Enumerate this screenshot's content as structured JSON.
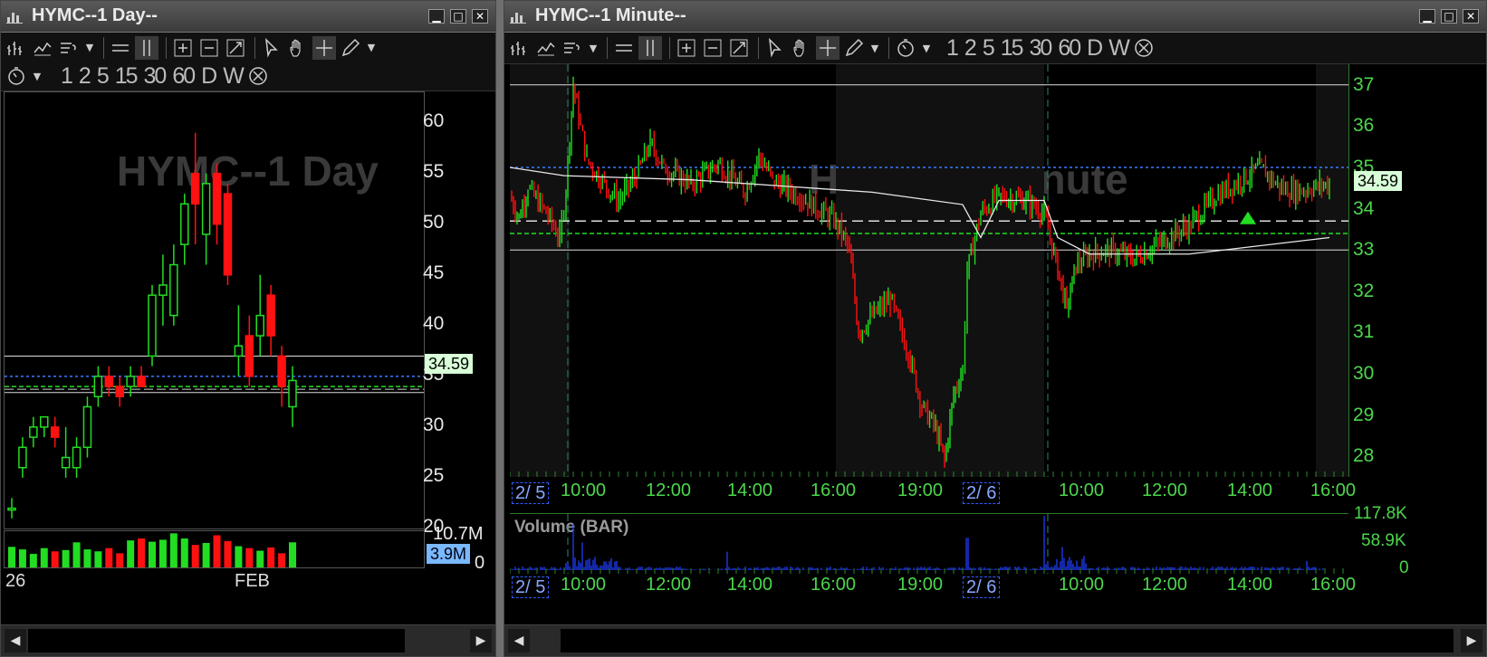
{
  "colors": {
    "up": "#22dd22",
    "down": "#ff1111",
    "level_green": "#22dd22",
    "level_blue": "#3a7bff",
    "volume": "#1e3cff",
    "accent": "#4cd64c"
  },
  "left_window": {
    "title": "HYMC--1 Day--",
    "watermark": "HYMC--1 Day",
    "timeframes": [
      "1",
      "2",
      "5",
      "15",
      "30",
      "60",
      "D",
      "W"
    ],
    "y_labels": [
      "60",
      "55",
      "50",
      "45",
      "40",
      "35",
      "30",
      "25",
      "20"
    ],
    "price_tag": "34.59",
    "volume_max": "10.7M",
    "volume_tag": "3.9M",
    "volume_zero": "0",
    "x_labels": [
      "26",
      "FEB"
    ]
  },
  "right_window": {
    "title": "HYMC--1 Minute--",
    "watermark": "HYMC--1 Minute",
    "timeframes": [
      "1",
      "2",
      "5",
      "15",
      "30",
      "60",
      "D",
      "W"
    ],
    "y_labels": [
      "37",
      "36",
      "35",
      "34",
      "33",
      "32",
      "31",
      "30",
      "29",
      "28"
    ],
    "price_tag": "34.59",
    "x_labels": [
      "10:00",
      "12:00",
      "14:00",
      "16:00",
      "19:00",
      "10:00",
      "12:00",
      "14:00",
      "16:00"
    ],
    "date_labels": [
      "2/ 5",
      "2/ 6"
    ],
    "volume_title": "Volume (BAR)",
    "volume_labels": [
      "117.8K",
      "58.9K",
      "0"
    ]
  },
  "chart_data": [
    {
      "type": "candlestick",
      "series_name": "HYMC",
      "timeframe": "1 Day",
      "ohlc": [
        [
          22,
          23,
          21,
          22
        ],
        [
          26,
          29,
          25,
          28
        ],
        [
          29,
          31,
          28,
          30
        ],
        [
          30,
          31,
          29,
          31
        ],
        [
          30,
          31,
          28,
          29
        ],
        [
          26,
          30,
          25,
          27
        ],
        [
          26,
          29,
          25,
          28
        ],
        [
          28,
          33,
          27,
          32
        ],
        [
          33,
          36,
          32,
          35
        ],
        [
          35,
          36,
          33,
          34
        ],
        [
          34,
          35,
          32,
          33
        ],
        [
          34,
          36,
          33,
          35
        ],
        [
          35,
          36,
          34,
          34
        ],
        [
          37,
          44,
          36,
          43
        ],
        [
          43,
          47,
          40,
          44
        ],
        [
          41,
          48,
          40,
          46
        ],
        [
          48,
          53,
          46,
          52
        ],
        [
          55,
          59,
          48,
          52
        ],
        [
          49,
          55,
          46,
          54
        ],
        [
          55,
          56,
          48,
          50
        ],
        [
          53,
          54,
          44,
          45
        ],
        [
          37,
          42,
          35,
          38
        ],
        [
          39,
          41,
          34,
          35
        ],
        [
          39,
          45,
          37,
          41
        ],
        [
          43,
          44,
          37,
          39
        ],
        [
          37,
          38,
          32,
          34
        ],
        [
          32,
          36,
          30,
          34.59
        ]
      ],
      "volume": [
        3.2,
        2.8,
        2.1,
        3.0,
        2.5,
        2.7,
        3.9,
        2.8,
        2.5,
        3.0,
        2.2,
        4.2,
        4.5,
        4.0,
        4.3,
        5.3,
        4.5,
        3.5,
        3.8,
        5.0,
        4.1,
        3.3,
        3.0,
        2.6,
        3.1,
        2.2,
        3.9
      ],
      "y_range": [
        20,
        63
      ],
      "volume_max": 10.7,
      "levels": {
        "upper_white": 37,
        "blue": 35,
        "green": 34,
        "lower_white": 33.4
      },
      "last_price": 34.59
    },
    {
      "type": "candlestick",
      "series_name": "HYMC",
      "timeframe": "1 Minute",
      "path_x_y": [
        [
          0,
          34.3
        ],
        [
          10,
          33.8
        ],
        [
          20,
          34.5
        ],
        [
          40,
          33.9
        ],
        [
          55,
          33.3
        ],
        [
          62,
          34.5
        ],
        [
          70,
          37.0
        ],
        [
          78,
          36.0
        ],
        [
          85,
          35.2
        ],
        [
          100,
          34.7
        ],
        [
          120,
          34.2
        ],
        [
          140,
          34.8
        ],
        [
          155,
          35.6
        ],
        [
          170,
          35.0
        ],
        [
          200,
          34.6
        ],
        [
          230,
          35.1
        ],
        [
          260,
          34.4
        ],
        [
          275,
          35.3
        ],
        [
          290,
          34.7
        ],
        [
          320,
          34.3
        ],
        [
          360,
          33.7
        ],
        [
          375,
          33.0
        ],
        [
          385,
          31.0
        ],
        [
          400,
          31.4
        ],
        [
          420,
          31.8
        ],
        [
          440,
          30.5
        ],
        [
          455,
          29.2
        ],
        [
          470,
          28.7
        ],
        [
          480,
          27.9
        ],
        [
          490,
          29.5
        ],
        [
          500,
          30.1
        ],
        [
          505,
          32.5
        ],
        [
          520,
          33.9
        ],
        [
          540,
          34.3
        ],
        [
          570,
          34.2
        ],
        [
          590,
          33.9
        ],
        [
          605,
          32.5
        ],
        [
          615,
          31.6
        ],
        [
          625,
          32.6
        ],
        [
          640,
          32.9
        ],
        [
          660,
          33.0
        ],
        [
          690,
          32.8
        ],
        [
          720,
          33.2
        ],
        [
          750,
          33.6
        ],
        [
          780,
          34.3
        ],
        [
          800,
          34.6
        ],
        [
          830,
          35.0
        ],
        [
          850,
          34.5
        ],
        [
          870,
          34.4
        ],
        [
          890,
          34.55
        ],
        [
          905,
          34.59
        ]
      ],
      "vwap": [
        [
          0,
          35.0
        ],
        [
          60,
          34.8
        ],
        [
          200,
          34.7
        ],
        [
          400,
          34.4
        ],
        [
          500,
          34.1
        ],
        [
          520,
          33.3
        ],
        [
          540,
          34.2
        ],
        [
          590,
          34.2
        ],
        [
          605,
          33.3
        ],
        [
          640,
          32.9
        ],
        [
          750,
          32.9
        ],
        [
          905,
          33.3
        ]
      ],
      "volume_spikes": [
        [
          70,
          100
        ],
        [
          80,
          60
        ],
        [
          240,
          40
        ],
        [
          505,
          70
        ],
        [
          590,
          117.8
        ],
        [
          610,
          50
        ],
        [
          880,
          20
        ]
      ],
      "y_range": [
        27.5,
        37.5
      ],
      "levels": {
        "upper_white": 37,
        "blue": 35,
        "white_dashed": 33.7,
        "green": 33.4,
        "lower_white": 33.0
      },
      "last_price": 34.59
    }
  ]
}
